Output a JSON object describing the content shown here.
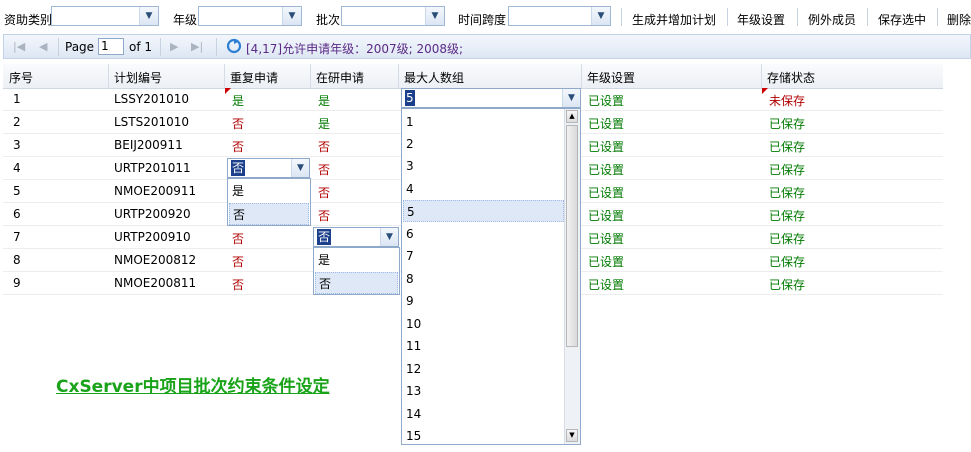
{
  "toolbar": {
    "funding_type_label": "资助类别",
    "grade_label": "年级",
    "batch_label": "批次",
    "timespan_label": "时间跨度",
    "generate_button": "生成并增加计划",
    "grade_settings_button": "年级设置",
    "exception_members_button": "例外成员",
    "save_selected_button": "保存选中",
    "delete_button": "删除"
  },
  "pager": {
    "page_label": "Page",
    "page_value": "1",
    "of_label": "of 1",
    "info": "[4,17]允许申请年级：2007级; 2008级;"
  },
  "columns": [
    "序号",
    "计划编号",
    "重复申请",
    "在研申请",
    "最大人数组",
    "年级设置",
    "存储状态"
  ],
  "rows": [
    {
      "no": "1",
      "code": "LSSY201010",
      "repeat": "是",
      "inresearch": "是",
      "max": "5",
      "grade": "已设置",
      "status": "未保存"
    },
    {
      "no": "2",
      "code": "LSTS201010",
      "repeat": "否",
      "inresearch": "是",
      "max": "",
      "grade": "已设置",
      "status": "已保存"
    },
    {
      "no": "3",
      "code": "BEIJ200911",
      "repeat": "否",
      "inresearch": "否",
      "max": "",
      "grade": "已设置",
      "status": "已保存"
    },
    {
      "no": "4",
      "code": "URTP201011",
      "repeat": "否",
      "inresearch": "否",
      "max": "",
      "grade": "已设置",
      "status": "已保存"
    },
    {
      "no": "5",
      "code": "NMOE200911",
      "repeat": "",
      "inresearch": "否",
      "max": "",
      "grade": "已设置",
      "status": "已保存"
    },
    {
      "no": "6",
      "code": "URTP200920",
      "repeat": "",
      "inresearch": "否",
      "max": "",
      "grade": "已设置",
      "status": "已保存"
    },
    {
      "no": "7",
      "code": "URTP200910",
      "repeat": "否",
      "inresearch": "否",
      "max": "",
      "grade": "已设置",
      "status": "已保存"
    },
    {
      "no": "8",
      "code": "NMOE200812",
      "repeat": "否",
      "inresearch": "",
      "max": "",
      "grade": "已设置",
      "status": "已保存"
    },
    {
      "no": "9",
      "code": "NMOE200811",
      "repeat": "否",
      "inresearch": "",
      "max": "",
      "grade": "已设置",
      "status": "已保存"
    }
  ],
  "repeat_editor": {
    "value": "否",
    "options": [
      "是",
      "否"
    ],
    "highlighted": "否"
  },
  "inresearch_editor": {
    "value": "否",
    "options": [
      "是",
      "否"
    ],
    "highlighted": "否"
  },
  "max_editor": {
    "value": "5",
    "options": [
      "1",
      "2",
      "3",
      "4",
      "5",
      "6",
      "7",
      "8",
      "9",
      "10",
      "11",
      "12",
      "13",
      "14",
      "15"
    ],
    "highlighted": "5"
  },
  "caption": "CxServer中项目批次约束条件设定",
  "colors": {
    "yes": "#007a00",
    "no": "#b00000",
    "caption": "#19a319",
    "selection": "#1b3f8b"
  },
  "icons": {
    "first": "first-page-icon",
    "prev": "prev-page-icon",
    "next": "next-page-icon",
    "last": "last-page-icon",
    "refresh": "refresh-icon",
    "dropdown": "chevron-down-icon"
  }
}
